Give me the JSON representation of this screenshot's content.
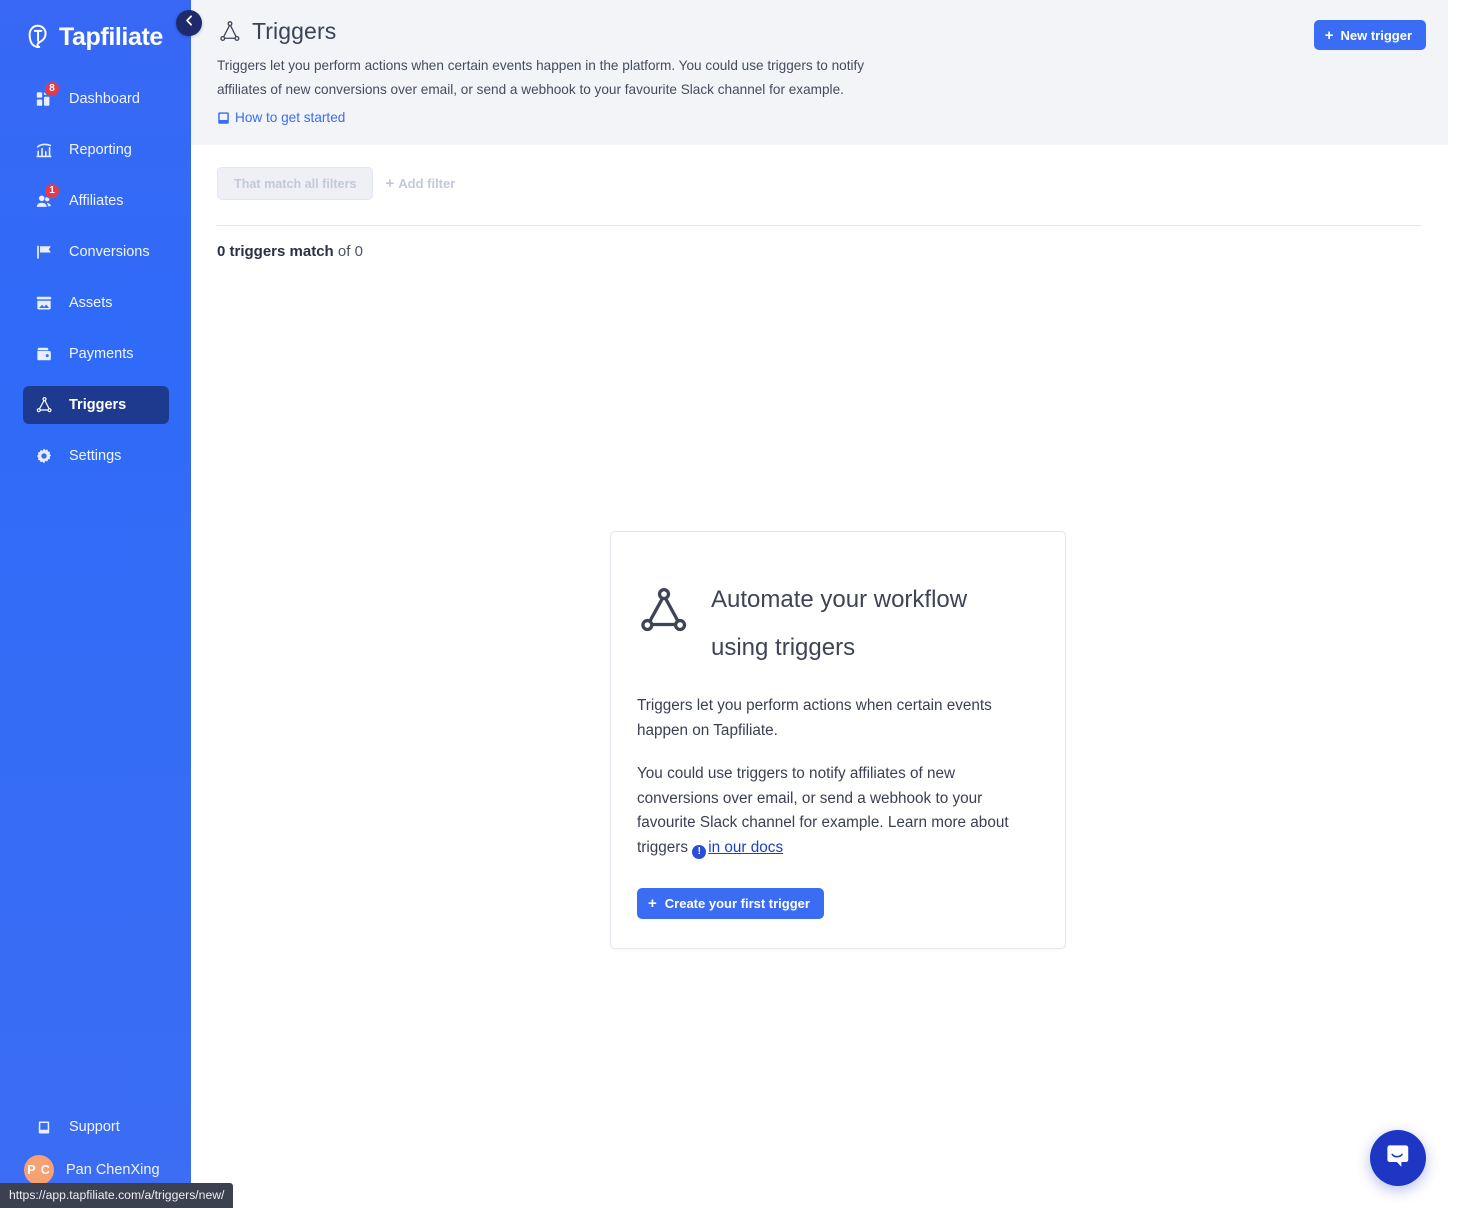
{
  "brand": {
    "name": "Tapfiliate",
    "sidebar_color": "#3a6df4",
    "accent_color": "#3a6df4",
    "active_item_color": "#1e3a8f",
    "badge_color": "#e03b4f"
  },
  "sidebar": {
    "logo_label": "Tapfiliate",
    "collapse_label": "Collapse sidebar",
    "items": [
      {
        "id": "dashboard",
        "label": "Dashboard",
        "icon": "dashboard-icon",
        "badge": "8",
        "active": false
      },
      {
        "id": "reporting",
        "label": "Reporting",
        "icon": "reporting-icon",
        "badge": null,
        "active": false
      },
      {
        "id": "affiliates",
        "label": "Affiliates",
        "icon": "affiliates-icon",
        "badge": "1",
        "active": false
      },
      {
        "id": "conversions",
        "label": "Conversions",
        "icon": "flag-icon",
        "badge": null,
        "active": false
      },
      {
        "id": "assets",
        "label": "Assets",
        "icon": "assets-icon",
        "badge": null,
        "active": false
      },
      {
        "id": "payments",
        "label": "Payments",
        "icon": "wallet-icon",
        "badge": null,
        "active": false
      },
      {
        "id": "triggers",
        "label": "Triggers",
        "icon": "triggers-icon",
        "badge": null,
        "active": true
      },
      {
        "id": "settings",
        "label": "Settings",
        "icon": "gear-icon",
        "badge": null,
        "active": false
      }
    ],
    "support_label": "Support",
    "user": {
      "name": "Pan ChenXing",
      "initials": "P C",
      "avatar_color": "#f7a071"
    }
  },
  "header": {
    "title": "Triggers",
    "title_icon": "triggers-icon",
    "description": "Triggers let you perform actions when certain events happen in the platform. You could use triggers to notify affiliates of new conversions over email, or send a webhook to your favourite Slack channel for example.",
    "help_link": "How to get started",
    "help_link_icon": "book-icon",
    "new_trigger_button": "New trigger",
    "new_trigger_icon": "plus-icon"
  },
  "filters": {
    "match_pill": "That match all filters",
    "add_filter": "Add filter",
    "add_filter_icon": "plus-icon"
  },
  "results": {
    "count_bold": "0 triggers match",
    "count_rest": " of 0"
  },
  "empty_state": {
    "icon": "triggers-icon",
    "title": "Automate your workflow using triggers",
    "paragraph_1": "Triggers let you perform actions when certain events happen on Tapfiliate.",
    "paragraph_2_before": "You could use triggers to notify affiliates of new conversions over email, or send a webhook to your favourite Slack channel for example. Learn more about triggers ",
    "docs_link": "in our docs",
    "docs_link_icon": "info-icon",
    "cta_label": "Create your first trigger",
    "cta_icon": "plus-icon"
  },
  "chat": {
    "icon": "chat-bubble-icon",
    "label": "Open chat"
  },
  "status_bar": {
    "url": "https://app.tapfiliate.com/a/triggers/new/"
  }
}
